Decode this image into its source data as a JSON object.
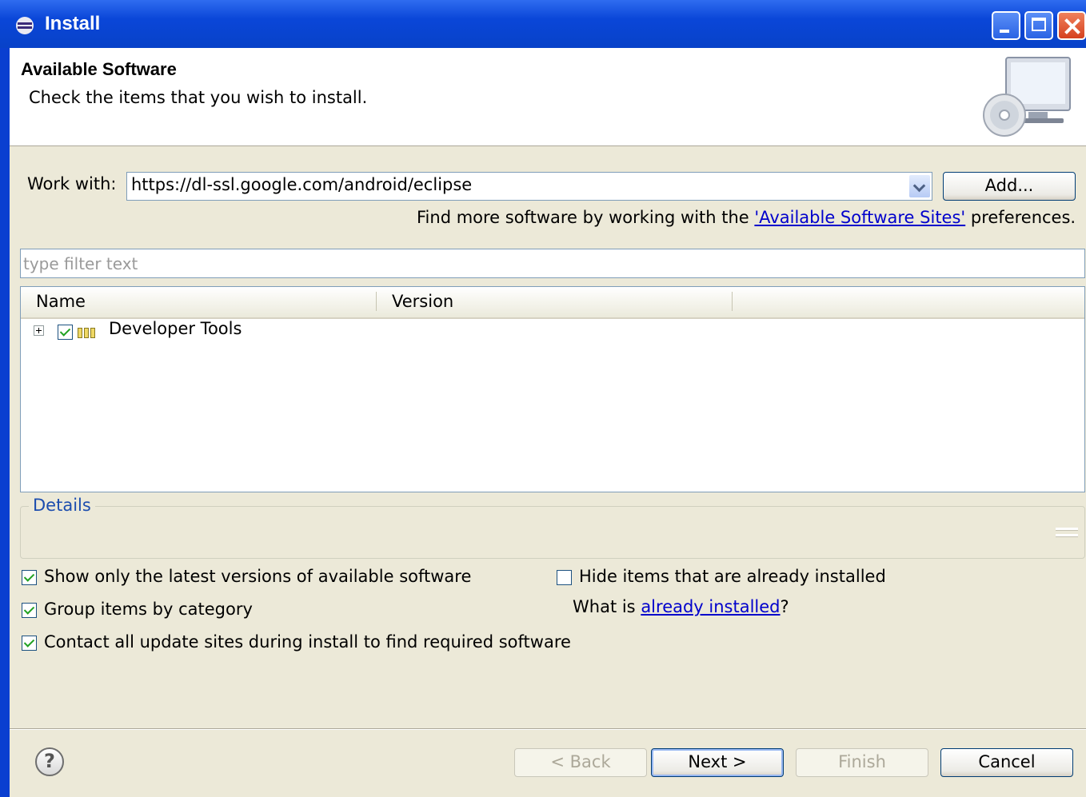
{
  "window": {
    "title": "Install"
  },
  "header": {
    "title": "Available Software",
    "description": "Check the items that you wish to install."
  },
  "work_with": {
    "label": "Work with:",
    "value": "https://dl-ssl.google.com/android/eclipse",
    "add_button": "Add...",
    "hint_prefix": "Find more software by working with the ",
    "hint_link": "'Available Software Sites'",
    "hint_suffix": " preferences."
  },
  "filter": {
    "placeholder": "type filter text",
    "value": ""
  },
  "tree": {
    "columns": [
      "Name",
      "Version"
    ],
    "items": [
      {
        "name": "Developer Tools",
        "checked": true,
        "expanded": false
      }
    ]
  },
  "details": {
    "title": "Details"
  },
  "options": {
    "show_latest": {
      "label": "Show only the latest versions of available software",
      "checked": true
    },
    "group_by_category": {
      "label": "Group items by category",
      "checked": true
    },
    "contact_sites": {
      "label": "Contact all update sites during install to find required software",
      "checked": true
    },
    "hide_installed": {
      "label": "Hide items that are already installed",
      "checked": false
    },
    "what_is_prefix": "What is ",
    "what_is_link": "already installed",
    "what_is_suffix": "?"
  },
  "buttons": {
    "back": "< Back",
    "next": "Next >",
    "finish": "Finish",
    "cancel": "Cancel"
  },
  "icons": [
    "eclipse-icon",
    "minimize-icon",
    "maximize-icon",
    "close-icon",
    "install-wizard-icon",
    "dropdown-arrow-icon",
    "expand-icon",
    "category-icon",
    "help-icon"
  ]
}
